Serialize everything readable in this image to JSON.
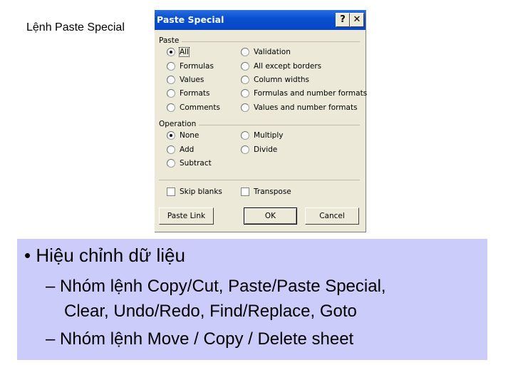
{
  "caption": "Lệnh Paste Special",
  "dialog": {
    "title": "Paste Special",
    "help_icon": "?",
    "close_icon": "✕",
    "paste_group": "Paste",
    "paste_options_left": [
      "All",
      "Formulas",
      "Values",
      "Formats",
      "Comments"
    ],
    "paste_options_right": [
      "Validation",
      "All except borders",
      "Column widths",
      "Formulas and number formats",
      "Values and number formats"
    ],
    "paste_selected": "All",
    "operation_group": "Operation",
    "operation_left": [
      "None",
      "Add",
      "Subtract"
    ],
    "operation_right": [
      "Multiply",
      "Divide"
    ],
    "operation_selected": "None",
    "skip_blanks": {
      "label": "Skip blanks",
      "checked": false
    },
    "transpose": {
      "label": "Transpose",
      "checked": false
    },
    "buttons": {
      "paste_link": "Paste Link",
      "ok": "OK",
      "cancel": "Cancel"
    }
  },
  "slide": {
    "bullet": "• Hiệu chỉnh dữ liệu",
    "sub_items": [
      "– Nhóm lệnh Copy/Cut, Paste/Paste Special,",
      "Clear, Undo/Redo, Find/Replace, Goto",
      "– Nhóm lệnh Move / Copy / Delete sheet"
    ]
  },
  "colors": {
    "titlebar": "#0a4fd0",
    "panel": "#ccccfa",
    "dialog_bg": "#ece9d8"
  }
}
